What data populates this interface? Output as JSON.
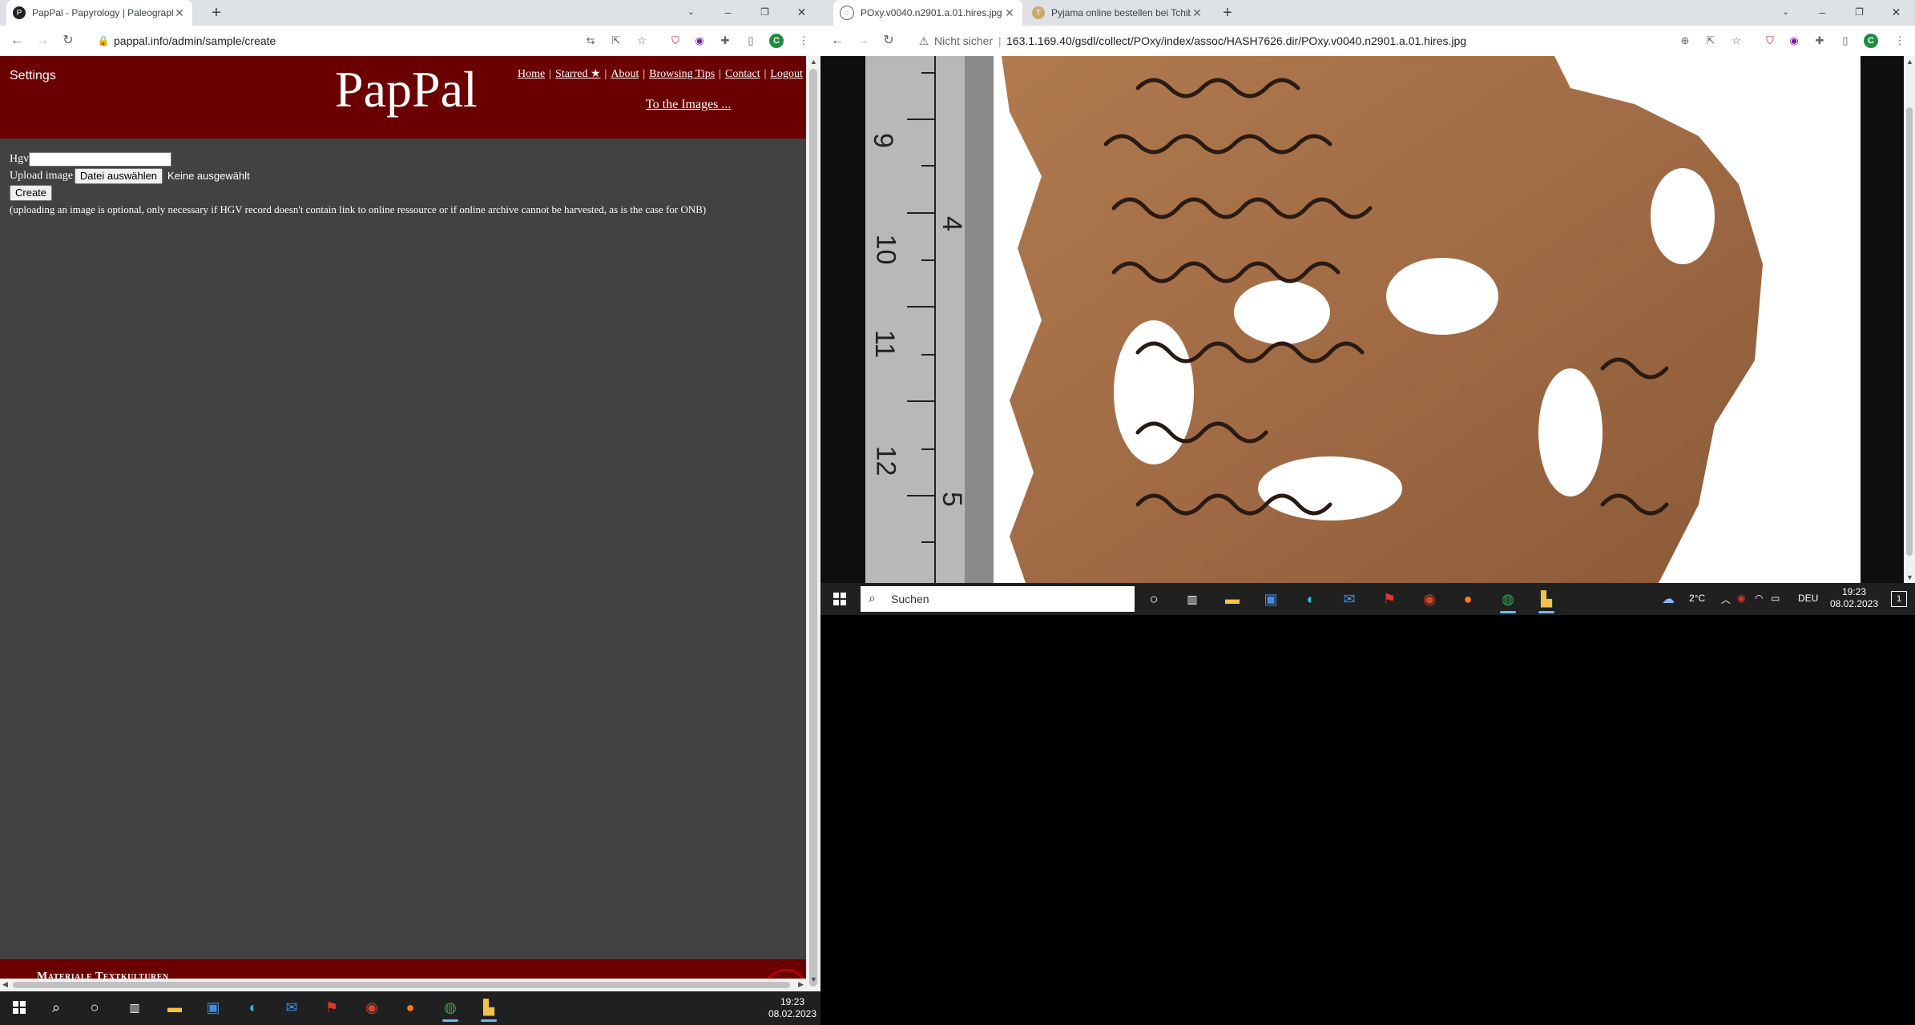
{
  "left_browser": {
    "tab": {
      "title": "PapPal - Papyrology | Paleograph",
      "icon": "pappal-favicon"
    },
    "url": "pappal.info/admin/sample/create",
    "profile_initial": "C"
  },
  "pappal": {
    "settings_label": "Settings",
    "logo": "PapPal",
    "nav": [
      "Home",
      "Starred ★",
      "About",
      "Browsing Tips",
      "Contact",
      "Logout"
    ],
    "to_images_link": "To the Images ...",
    "form": {
      "hgv_label": "Hgv",
      "hgv_value": "",
      "upload_label": "Upload image",
      "choose_file_button": "Datei auswählen",
      "file_status": "Keine ausgewählt",
      "create_button": "Create",
      "note": "(uploading an image is optional, only necessary if HGV record doesn't contain link to online ressource or if online archive cannot be harvested, as is the case for ONB)"
    },
    "footer_text": "Materiale Textkulturen",
    "colors": {
      "header": "#6b0000",
      "body": "#424242"
    }
  },
  "right_browser": {
    "tabs": [
      {
        "title": "POxy.v0040.n2901.a.01.hires.jpg",
        "icon": "globe-icon"
      },
      {
        "title": "Pyjama online bestellen bei Tchibo",
        "icon": "tchibo-icon"
      }
    ],
    "security_label": "Nicht sicher",
    "url": "163.1.169.40/gsdl/collect/POxy/index/assoc/HASH7626.dir/POxy.v0040.n2901.a.01.hires.jpg",
    "profile_initial": "C",
    "ruler_numbers": [
      "9",
      "10",
      "11",
      "12",
      "4",
      "5"
    ]
  },
  "taskbar_right": {
    "search_placeholder": "Suchen",
    "weather": "2°C",
    "language": "DEU",
    "time": "19:23",
    "date": "08.02.2023",
    "notification_count": "1"
  },
  "taskbar_left": {
    "time": "19:23",
    "date": "08.02.2023"
  }
}
